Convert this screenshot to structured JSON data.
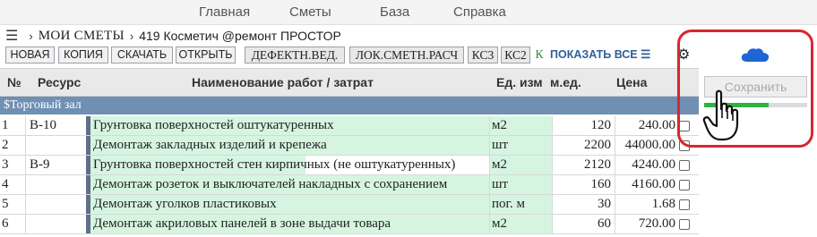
{
  "nav": {
    "items": [
      "Главная",
      "Сметы",
      "База",
      "Справка"
    ]
  },
  "breadcrumb": {
    "menu_icon": "hamburger-icon",
    "root": "МОИ СМЕТЫ",
    "project": "419 Косметич @ремонт ПРОСТОР"
  },
  "toolbar": {
    "new": "НОВАЯ",
    "copy": "КОПИЯ",
    "download": "СКАЧАТЬ",
    "open": "ОТКРЫТЬ",
    "defect": "ДЕФЕКТН.ВЕД.",
    "local": "ЛОК.СМЕТН.РАСЧ",
    "ks3": "КС3",
    "ks2": "КС2",
    "k": "К",
    "show_all": "ПОКАЗАТЬ ВСЕ ☰",
    "settings_icon": "gear-icon"
  },
  "table": {
    "headers": {
      "num": "№",
      "resource": "Ресурс",
      "name": "Наименование работ / затрат",
      "unit": "Ед. изм",
      "qty": "м.ед.",
      "price": "Цена"
    },
    "section": "$Торговый зал",
    "rows": [
      {
        "num": "1",
        "resource": "В-10",
        "name": "Грунтовка поверхностей оштукатуренных",
        "unit": "м2",
        "qty": "120",
        "price": "240.00"
      },
      {
        "num": "2",
        "resource": "",
        "name": "Демонтаж закладных изделий и крепежа",
        "unit": "шт",
        "qty": "2200",
        "price": "44000.00"
      },
      {
        "num": "3",
        "resource": "В-9",
        "name": "Грунтовка поверхностей стен кирпичных (не оштукатуренных)",
        "unit": "м2",
        "qty": "2120",
        "price": "4240.00"
      },
      {
        "num": "4",
        "resource": "",
        "name": "Демонтаж розеток и выключателей накладных с сохранением",
        "unit": "шт",
        "qty": "160",
        "price": "4160.00"
      },
      {
        "num": "5",
        "resource": "",
        "name": "Демонтаж уголков пластиковых",
        "unit": "пог. м",
        "qty": "30",
        "price": "1.68"
      },
      {
        "num": "6",
        "resource": "",
        "name": "Демонтаж акриловых панелей в зоне выдачи товара",
        "unit": "м2",
        "qty": "60",
        "price": "720.00"
      }
    ]
  },
  "side_panel": {
    "cloud_icon": "cloud-icon",
    "save_label": "Сохранить",
    "progress": 0.63,
    "cursor_icon": "hand-pointer-icon",
    "highlight_color": "#d8262e"
  }
}
